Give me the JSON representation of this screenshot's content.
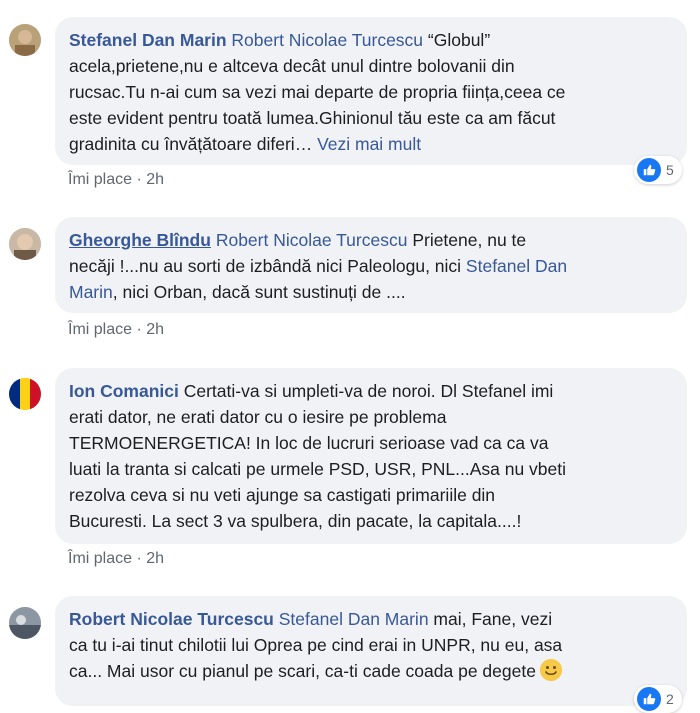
{
  "comments": [
    {
      "author": "Stefanel Dan Marin",
      "tag": "Robert Nicolae Turcescu",
      "lines": [
        " “Globul”",
        "acela,prietene,nu e altceva decât unul dintre bolovanii din",
        "rucsac.Tu n-ai cum sa vezi mai departe de propria ființa,ceea ce",
        "este evident pentru toată lumea.Ghinionul tău este ca am făcut",
        "gradinita cu învățătoare diferi… "
      ],
      "see_more": "Vezi mai mult",
      "like": "Îmi place",
      "time": "2h",
      "reaction_count": "5"
    },
    {
      "author": "Gheorghe Blîndu",
      "tag": "Robert Nicolae Turcescu",
      "line1": " Prietene, nu te",
      "line2a": "necăji !...nu au sorti de izbândă nici Paleologu, nici ",
      "tag2a": "Stefanel Dan",
      "tag2b": "Marin",
      "line3": ", nici Orban, dacă sunt sustinuți de ....",
      "like": "Îmi place",
      "time": "2h"
    },
    {
      "author": "Ion Comanici",
      "lines": [
        " Certati-va si umpleti-va de noroi. Dl Stefanel imi",
        "erati dator, ne erati dator cu o iesire pe problema",
        "TERMOENERGETICA! In loc de lucruri serioase vad ca ca va",
        "luati la tranta si calcati pe urmele PSD, USR, PNL...Asa nu vbeti",
        "rezolva ceva si nu veti ajunge sa castigati primariile din",
        "Bucuresti. La sect 3 va spulbera, din pacate, la capitala....!"
      ],
      "like": "Îmi place",
      "time": "2h"
    },
    {
      "author": "Robert Nicolae Turcescu",
      "tag": "Stefanel Dan Marin",
      "lines": [
        " mai, Fane, vezi",
        "ca tu i-ai tinut chilotii lui Oprea pe cind erai in UNPR, nu eu, asa",
        "ca... Mai usor cu pianul pe scari, ca-ti cade coada pe degete"
      ],
      "reaction_count": "2"
    }
  ],
  "colors": {
    "link": "#385898",
    "bubble": "#f0f2f5",
    "like_blue": "#1877f2"
  },
  "icons": [
    "like-reaction-icon",
    "smile-emoji-icon",
    "romania-flag-avatar"
  ]
}
